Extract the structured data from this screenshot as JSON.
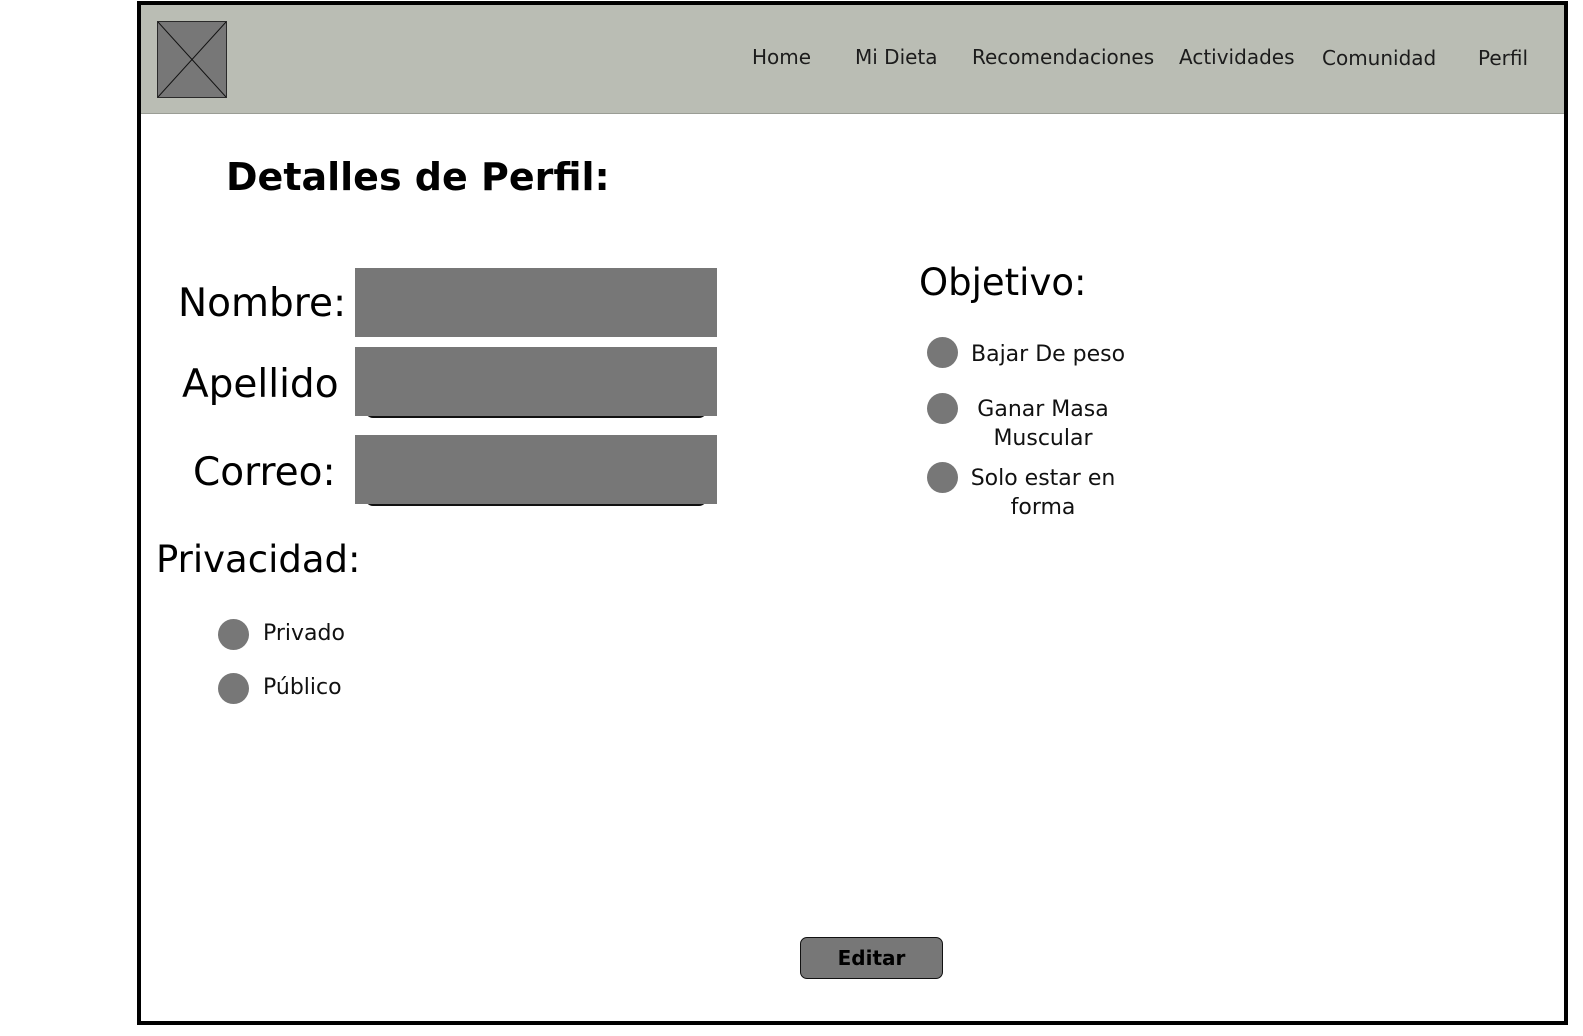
{
  "header": {
    "nav": [
      "Home",
      "Mi Dieta",
      "Recomendaciones",
      "Actividades",
      "Comunidad",
      "Perfil"
    ]
  },
  "page_title": "Detalles de Perfil:",
  "form": {
    "nombre_label": "Nombre:",
    "apellido_label": "Apellido",
    "correo_label": "Correo:",
    "nombre_value": "",
    "apellido_value": "",
    "correo_value": ""
  },
  "privacy": {
    "title": "Privacidad:",
    "options": [
      "Privado",
      "Público"
    ]
  },
  "objective": {
    "title": "Objetivo:",
    "options": [
      "Bajar De peso",
      "Ganar Masa Muscular",
      "Solo estar en forma"
    ]
  },
  "edit_button": "Editar",
  "colors": {
    "header_bg": "#babdb4",
    "placeholder_gray": "#777777",
    "frame_border": "#000000"
  },
  "icons": {
    "logo": "image-placeholder-icon",
    "radio": "radio-button-icon"
  }
}
